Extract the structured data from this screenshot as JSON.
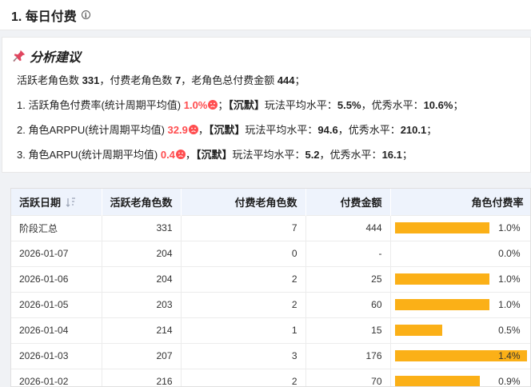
{
  "header": {
    "title": "1. 每日付费"
  },
  "advice": {
    "title": "分析建议",
    "summary": {
      "p1": "活跃老角色数 ",
      "active": "331",
      "p2": "，付费老角色数 ",
      "paying": "7",
      "p3": "，老角色总付费金额 ",
      "amount": "444",
      "p4": "；"
    },
    "lines": [
      {
        "prefix": "1. 活跃角色付费率(统计周期平均值) ",
        "value": "1.0%",
        "tag": "【沉默】",
        "avg_label": "玩法平均水平：",
        "avg": "5.5%",
        "sep": "，优秀水平：",
        "good": "10.6%",
        "end": "；"
      },
      {
        "prefix": "2. 角色ARPPU(统计周期平均值) ",
        "value": "32.9",
        "tag": "【沉默】",
        "avg_label": "玩法平均水平：",
        "avg": "94.6",
        "sep": "，优秀水平：",
        "good": "210.1",
        "end": "；"
      },
      {
        "prefix": "3. 角色ARPU(统计周期平均值) ",
        "value": "0.4",
        "tag": "【沉默】",
        "avg_label": "玩法平均水平：",
        "avg": "5.2",
        "sep": "，优秀水平：",
        "good": "16.1",
        "end": "；"
      }
    ]
  },
  "table": {
    "columns": [
      "活跃日期",
      "活跃老角色数",
      "付费老角色数",
      "付费金额",
      "角色付费率"
    ],
    "rows": [
      {
        "date": "阶段汇总",
        "active": "331",
        "paying": "7",
        "amount": "444",
        "rate": "1.0%",
        "rate_value": 1.0
      },
      {
        "date": "2026-01-07",
        "active": "204",
        "paying": "0",
        "amount": "-",
        "rate": "0.0%",
        "rate_value": 0.0
      },
      {
        "date": "2026-01-06",
        "active": "204",
        "paying": "2",
        "amount": "25",
        "rate": "1.0%",
        "rate_value": 1.0
      },
      {
        "date": "2026-01-05",
        "active": "203",
        "paying": "2",
        "amount": "60",
        "rate": "1.0%",
        "rate_value": 1.0
      },
      {
        "date": "2026-01-04",
        "active": "214",
        "paying": "1",
        "amount": "15",
        "rate": "0.5%",
        "rate_value": 0.5
      },
      {
        "date": "2026-01-03",
        "active": "207",
        "paying": "3",
        "amount": "176",
        "rate": "1.4%",
        "rate_value": 1.4
      },
      {
        "date": "2026-01-02",
        "active": "216",
        "paying": "2",
        "amount": "70",
        "rate": "0.9%",
        "rate_value": 0.9
      }
    ]
  },
  "colors": {
    "bar": "#fbb017",
    "alert": "#ff4d4f",
    "header_bg": "#eef3fc"
  },
  "icons": {
    "title": "info-icon",
    "advice": "pushpin-icon",
    "alert": "sad-face-icon",
    "sort": "sort-icon"
  }
}
